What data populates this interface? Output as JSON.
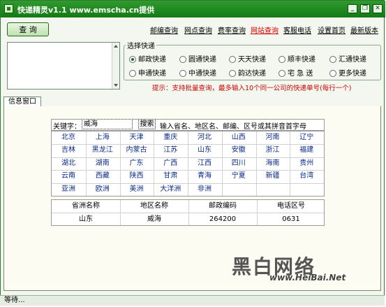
{
  "window": {
    "title": "快递精灵v1.1  www.emscha.cn提供",
    "minimize_glyph": "_",
    "restore_glyph": "❐",
    "close_glyph": "✕"
  },
  "toolbar": {
    "query_button": "查 询",
    "links": [
      "邮编查询",
      "网点查询",
      "费率查询",
      "网站查询",
      "客服电话",
      "设置首页",
      "最新版本"
    ],
    "active_link_color": "#d40000"
  },
  "express": {
    "group_label": "选择快递",
    "options": [
      "邮政快递",
      "圆通快递",
      "天天快递",
      "顺丰快递",
      "汇通快递",
      "申通快递",
      "中通快递",
      "韵达快递",
      "宅 急 送",
      "更多快递"
    ],
    "selected": "邮政快递"
  },
  "hint": "提示：支持批量查询，最多输入10个同一公司的快递单号(每行一个)",
  "info_tab": "信息窗口",
  "keyword": {
    "label": "关键字：",
    "value": "威海",
    "search_button": "搜索",
    "tip": "输入省名、地区名、邮编、区号或其拼音首字母"
  },
  "regions": [
    [
      "北京",
      "上海",
      "天津",
      "重庆",
      "河北",
      "山西",
      "河南",
      "辽宁"
    ],
    [
      "吉林",
      "黑龙江",
      "内蒙古",
      "江苏",
      "山东",
      "安徽",
      "浙江",
      "福建"
    ],
    [
      "湖北",
      "湖南",
      "广东",
      "广西",
      "江西",
      "四川",
      "海南",
      "贵州"
    ],
    [
      "云南",
      "西藏",
      "陕西",
      "甘肃",
      "青海",
      "宁夏",
      "新疆",
      "台湾"
    ],
    [
      "亚洲",
      "欧洲",
      "美洲",
      "大洋洲",
      "非洲",
      "",
      "",
      ""
    ]
  ],
  "result": {
    "headers": [
      "省洲名称",
      "地区名称",
      "邮政编码",
      "电话区号"
    ],
    "row": [
      "山东",
      "威海",
      "264200",
      "0631"
    ]
  },
  "watermark": {
    "text": "黑白网络",
    "url": "www.HeiBai.Net"
  },
  "status": "等待..."
}
